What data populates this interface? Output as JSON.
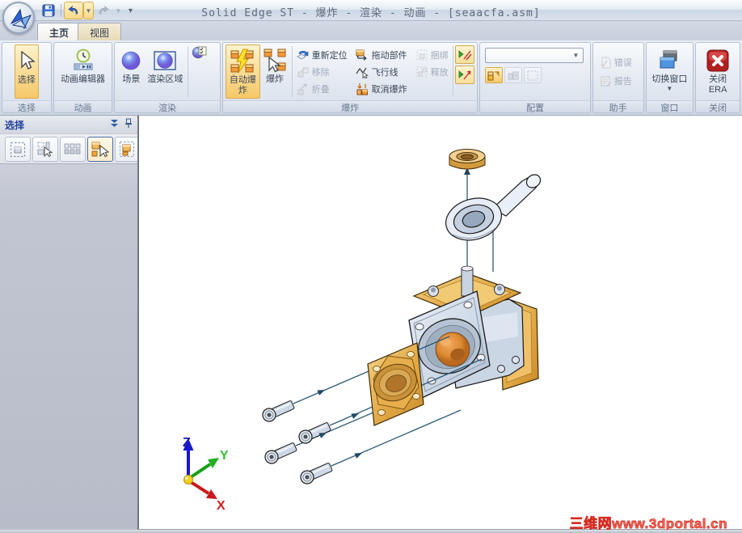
{
  "window": {
    "title": "Solid Edge ST - 爆炸 - 渲染 - 动画 - [seaacfa.asm]"
  },
  "tabs": {
    "home": "主页",
    "view": "视图"
  },
  "ribbon": {
    "select": {
      "group": "选择",
      "btn": "选择"
    },
    "anim": {
      "group": "动画",
      "btn": "动画编辑器"
    },
    "render": {
      "group": "渲染",
      "scene": "场景",
      "area": "渲染区域"
    },
    "explode": {
      "group": "爆炸",
      "auto": "自动爆炸",
      "explode": "爆炸",
      "reposition": "重新定位",
      "remove": "移除",
      "fold": "折叠",
      "drag": "拖动部件",
      "flight": "飞行线",
      "cancel": "取消爆炸",
      "bind": "捆绑",
      "release": "释放"
    },
    "config": {
      "group": "配置",
      "combo_value": ""
    },
    "helper": {
      "group": "助手",
      "errors": "错误",
      "report": "报告"
    },
    "win": {
      "group": "窗口",
      "switch": "切换窗口"
    },
    "close": {
      "group": "关闭",
      "line1": "关闭",
      "line2": "ERA"
    }
  },
  "panel": {
    "title": "选择"
  },
  "canvas": {
    "axis_x": "X",
    "axis_y": "Y",
    "axis_z": "Z",
    "watermark": "三维网www.3dportal.cn",
    "accent_flightline": "#2a5a78",
    "accent_brass": "#e0a743",
    "accent_steel": "#cdd8e6"
  }
}
